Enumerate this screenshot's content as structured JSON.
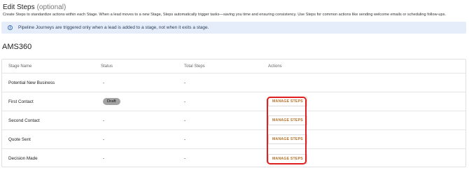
{
  "header": {
    "title": "Edit Steps",
    "optional": "(optional)",
    "description": "Create Steps to standardize actions within each Stage. When a lead moves to a new Stage, Steps automatically trigger tasks—saving you time and ensuring consistency. Use Steps for common actions like sending welcome emails or scheduling follow-ups."
  },
  "banner": {
    "icon": "info-icon",
    "text": "Pipeline Journeys are triggered only when a lead is added to a stage, not when it exits a stage."
  },
  "pipeline": {
    "name": "AMS360"
  },
  "table": {
    "columns": [
      "Stage Name",
      "Status",
      "Total Steps",
      "Actions"
    ],
    "rows": [
      {
        "stage": "Potential New Business",
        "status": "-",
        "total": "-",
        "action": ""
      },
      {
        "stage": "First Contact",
        "status": "Draft",
        "total": "-",
        "action": "MANAGE STEPS"
      },
      {
        "stage": "Second Contact",
        "status": "-",
        "total": "-",
        "action": "MANAGE STEPS"
      },
      {
        "stage": "Quote Sent",
        "status": "-",
        "total": "-",
        "action": "MANAGE STEPS"
      },
      {
        "stage": "Decision Made",
        "status": "-",
        "total": "-",
        "action": "MANAGE STEPS"
      }
    ]
  },
  "colors": {
    "banner_bg": "#e4edf9",
    "action_text": "#b5722a",
    "draft_badge": "#a3a3a3",
    "highlight": "#e02020"
  }
}
